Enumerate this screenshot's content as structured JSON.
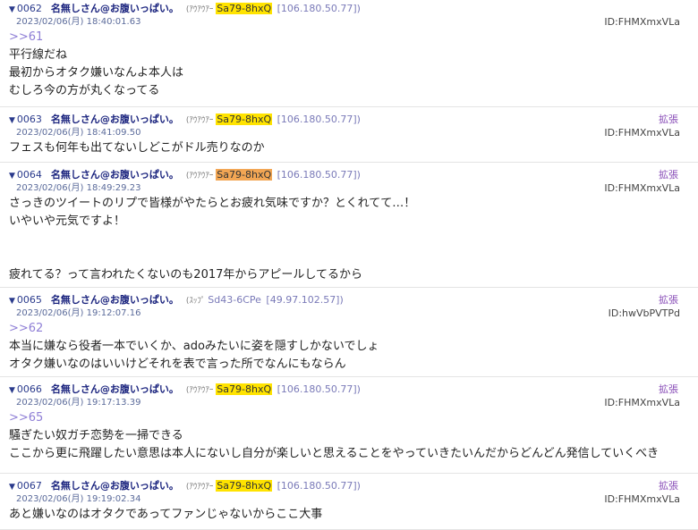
{
  "posts": [
    {
      "num": "0062",
      "name": "名無しさん@お腹いっぱい。",
      "kote": "(ｱｳｱｳｱｰ",
      "trip": "Sa79-8hxQ",
      "trip_style": "yellow",
      "ip": "[106.180.50.77])",
      "date": "2023/02/06(月) 18:40:01.63",
      "expand": "",
      "uid": "ID:FHMXmxVLa",
      "lines": [
        ">>61",
        "平行線だね",
        "最初からオタク嫌いなんよ本人は",
        "むしろ今の方が丸くなってる"
      ]
    },
    {
      "num": "0063",
      "name": "名無しさん@お腹いっぱい。",
      "kote": "(ｱｳｱｳｱｰ",
      "trip": "Sa79-8hxQ",
      "trip_style": "yellow",
      "ip": "[106.180.50.77])",
      "date": "2023/02/06(月) 18:41:09.50",
      "expand": "拡張",
      "uid": "ID:FHMXmxVLa",
      "lines": [
        "フェスも何年も出てないしどこがドル売りなのか"
      ]
    },
    {
      "num": "0064",
      "name": "名無しさん@お腹いっぱい。",
      "kote": "(ｱｳｱｳｱｰ",
      "trip": "Sa79-8hxQ",
      "trip_style": "orange",
      "ip": "[106.180.50.77])",
      "date": "2023/02/06(月) 18:49:29.23",
      "expand": "拡張",
      "uid": "ID:FHMXmxVLa",
      "lines": [
        "さっきのツイートのリプで皆様がやたらとお疲れ気味ですか？とくれてて…！",
        "いやいや元気ですよ！",
        "",
        "",
        "疲れてる？って言われたくないのも2017年からアピールしてるから"
      ]
    },
    {
      "num": "0065",
      "name": "名無しさん@お腹いっぱい。",
      "kote": "(ｽｯﾌﾟ",
      "trip": "Sd43-6CPe",
      "trip_style": "plain",
      "ip": "[49.97.102.57])",
      "date": "2023/02/06(月) 19:12:07.16",
      "expand": "拡張",
      "uid": "ID:hwVbPVTPd",
      "lines": [
        ">>62",
        "本当に嫌なら役者一本でいくか、adoみたいに姿を隠すしかないでしょ",
        "オタク嫌いなのはいいけどそれを表で言った所でなんにもならん"
      ]
    },
    {
      "num": "0066",
      "name": "名無しさん@お腹いっぱい。",
      "kote": "(ｱｳｱｳｱｰ",
      "trip": "Sa79-8hxQ",
      "trip_style": "yellow",
      "ip": "[106.180.50.77])",
      "date": "2023/02/06(月) 19:17:13.39",
      "expand": "拡張",
      "uid": "ID:FHMXmxVLa",
      "lines": [
        ">>65",
        "騒ぎたい奴ガチ恋勢を一掃できる",
        "ここから更に飛躍したい意思は本人にないし自分が楽しいと思えることをやっていきたいんだからどんどん発信していくべき"
      ]
    },
    {
      "num": "0067",
      "name": "名無しさん@お腹いっぱい。",
      "kote": "(ｱｳｱｳｱｰ",
      "trip": "Sa79-8hxQ",
      "trip_style": "yellow",
      "ip": "[106.180.50.77])",
      "date": "2023/02/06(月) 19:19:02.34",
      "expand": "拡張",
      "uid": "ID:FHMXmxVLa",
      "lines": [
        "あと嫌いなのはオタクであってファンじゃないからここ大事"
      ]
    }
  ]
}
